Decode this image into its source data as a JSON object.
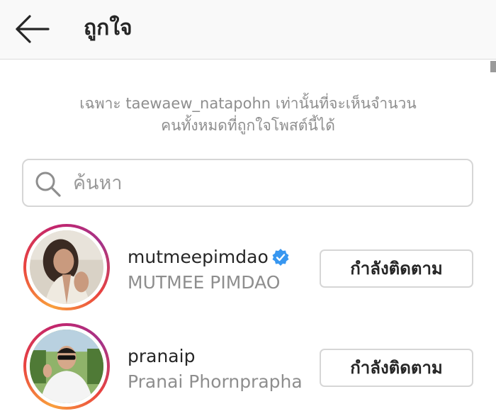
{
  "header": {
    "title": "ถูกใจ",
    "back_icon": "arrow-left-icon"
  },
  "notice": {
    "line1": "เฉพาะ taewaew_natapohn เท่านั้นที่จะเห็นจำนวน",
    "line2": "คนทั้งหมดที่ถูกใจโพสต์นี้ได้"
  },
  "search": {
    "placeholder": "ค้นหา",
    "value": "",
    "icon": "search-icon"
  },
  "likers": [
    {
      "username": "mutmeepimdao",
      "full_name": "MUTMEE PIMDAO",
      "verified": true,
      "follow_label": "กำลังติดตาม"
    },
    {
      "username": "pranaip",
      "full_name": "Pranai Phornprapha",
      "verified": false,
      "follow_label": "กำลังติดตาม"
    }
  ],
  "colors": {
    "verified_badge": "#3897f0",
    "secondary_text": "#8e8e8e",
    "border": "#d6d6d6"
  }
}
